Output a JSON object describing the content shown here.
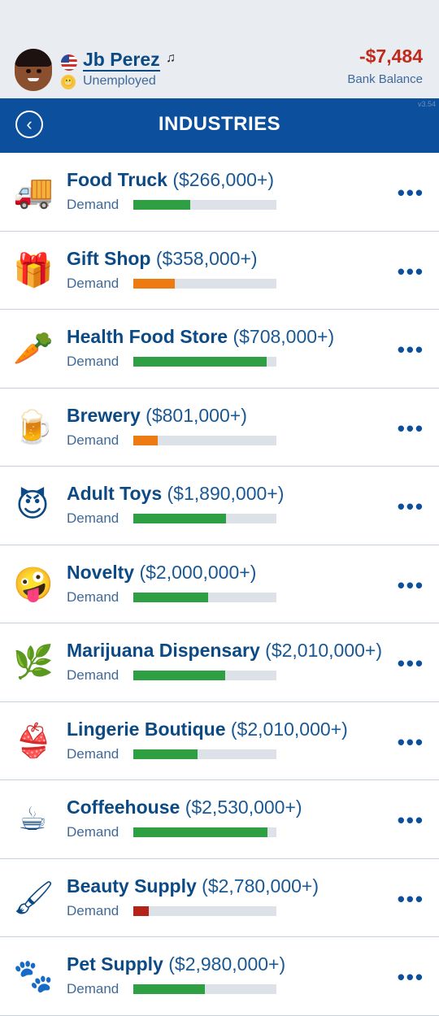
{
  "player": {
    "name": "Jb Perez",
    "note_icon": "♫",
    "status": "Unemployed",
    "balance": "-$7,484",
    "balance_label": "Bank Balance"
  },
  "header": {
    "title": "INDUSTRIES",
    "version": "v3.54",
    "back_icon": "‹"
  },
  "colors": {
    "green": "#2ea043",
    "orange": "#ee7a12",
    "red": "#b52218"
  },
  "industries": [
    {
      "name": "Food Truck",
      "price": "($266,000+)",
      "icon": "🚚",
      "demand": 0.4,
      "color": "#2ea043"
    },
    {
      "name": "Gift Shop",
      "price": "($358,000+)",
      "icon": "🎁",
      "demand": 0.29,
      "color": "#ee7a12"
    },
    {
      "name": "Health Food Store",
      "price": "($708,000+)",
      "icon": "🥕",
      "demand": 0.93,
      "color": "#2ea043"
    },
    {
      "name": "Brewery",
      "price": "($801,000+)",
      "icon": "🍺",
      "demand": 0.17,
      "color": "#ee7a12"
    },
    {
      "name": "Adult Toys",
      "price": "($1,890,000+)",
      "icon": "😈",
      "demand": 0.65,
      "color": "#2ea043"
    },
    {
      "name": "Novelty",
      "price": "($2,000,000+)",
      "icon": "🤪",
      "demand": 0.52,
      "color": "#2ea043"
    },
    {
      "name": "Marijuana Dispensary",
      "price": "($2,010,000+)",
      "icon": "🌿",
      "demand": 0.64,
      "color": "#2ea043"
    },
    {
      "name": "Lingerie Boutique",
      "price": "($2,010,000+)",
      "icon": "👙",
      "demand": 0.45,
      "color": "#2ea043"
    },
    {
      "name": "Coffeehouse",
      "price": "($2,530,000+)",
      "icon": "☕",
      "demand": 0.94,
      "color": "#2ea043"
    },
    {
      "name": "Beauty Supply",
      "price": "($2,780,000+)",
      "icon": "🖌",
      "demand": 0.11,
      "color": "#b52218"
    },
    {
      "name": "Pet Supply",
      "price": "($2,980,000+)",
      "icon": "🐾",
      "demand": 0.5,
      "color": "#2ea043"
    }
  ],
  "demand_label": "Demand",
  "more_label": "•••"
}
